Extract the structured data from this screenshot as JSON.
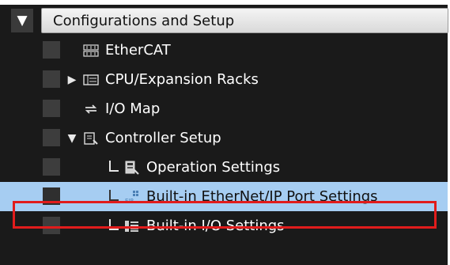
{
  "header": {
    "title": "Configurations and Setup",
    "toggle_glyph": "▼"
  },
  "tree": {
    "items": [
      {
        "label": "EtherCAT",
        "icon": "ethercat-icon",
        "expander": ""
      },
      {
        "label": "CPU/Expansion Racks",
        "icon": "rack-icon",
        "expander": "▶"
      },
      {
        "label": "I/O Map",
        "icon": "io-map-icon",
        "expander": ""
      },
      {
        "label": "Controller Setup",
        "icon": "controller-setup-icon",
        "expander": "▼"
      },
      {
        "label": "Operation Settings",
        "icon": "operation-settings-icon",
        "expander": ""
      },
      {
        "label": "Built-in EtherNet/IP Port Settings",
        "icon": "ethernet-ip-port-icon",
        "expander": "",
        "selected": true
      },
      {
        "label": "Built-in I/O Settings",
        "icon": "io-settings-icon",
        "expander": ""
      }
    ]
  },
  "colors": {
    "background": "#1a1a1a",
    "selection": "#a6cdf2",
    "highlight_outline": "#e11c1c"
  }
}
